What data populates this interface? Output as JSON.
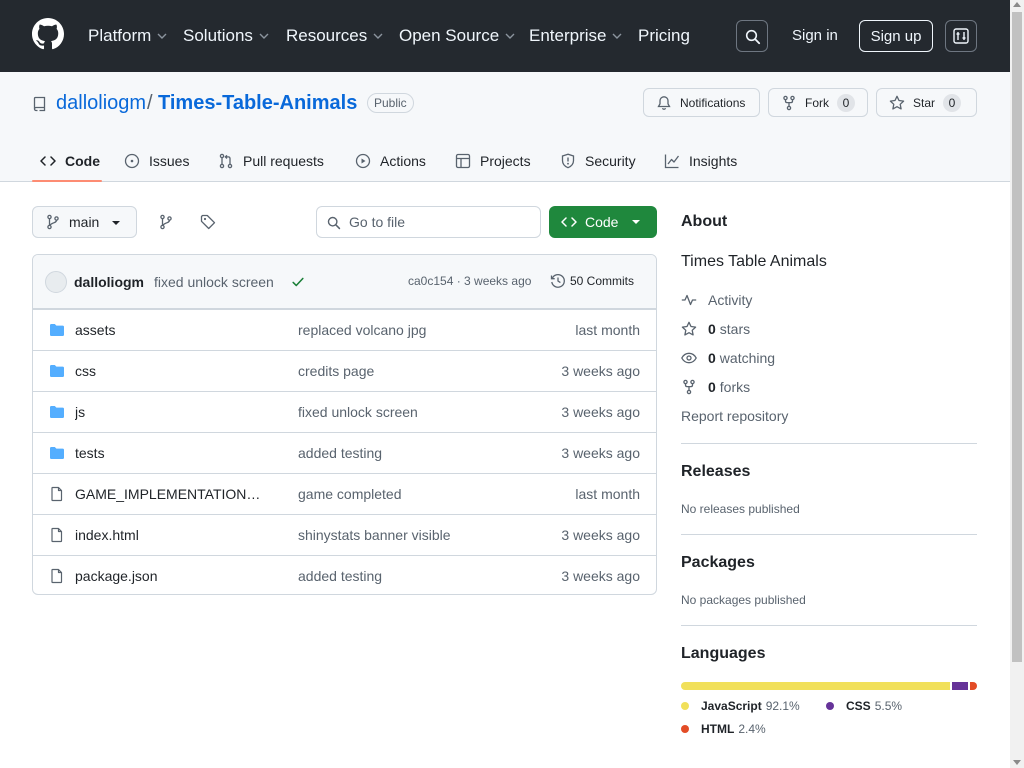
{
  "header": {
    "nav": [
      {
        "label": "Platform"
      },
      {
        "label": "Solutions"
      },
      {
        "label": "Resources"
      },
      {
        "label": "Open Source"
      },
      {
        "label": "Enterprise"
      },
      {
        "label": "Pricing"
      }
    ],
    "sign_in": "Sign in",
    "sign_up": "Sign up"
  },
  "repo": {
    "owner": "dalloliogm",
    "separator": "/",
    "name": "Times-Table-Animals",
    "visibility": "Public",
    "notifications_label": "Notifications",
    "fork_label": "Fork",
    "fork_count": "0",
    "star_label": "Star",
    "star_count": "0"
  },
  "tabs": [
    {
      "label": "Code",
      "icon": "code-icon"
    },
    {
      "label": "Issues",
      "icon": "issue-icon"
    },
    {
      "label": "Pull requests",
      "icon": "pull-request-icon"
    },
    {
      "label": "Actions",
      "icon": "play-icon"
    },
    {
      "label": "Projects",
      "icon": "table-icon"
    },
    {
      "label": "Security",
      "icon": "shield-icon"
    },
    {
      "label": "Insights",
      "icon": "graph-icon"
    }
  ],
  "toolbar": {
    "branch": "main",
    "goto_placeholder": "Go to file",
    "code_label": "Code"
  },
  "commit": {
    "author": "dalloliogm",
    "message": "fixed unlock screen",
    "hash_time": "ca0c154 · 3 weeks ago",
    "commits": "50 Commits"
  },
  "files": [
    {
      "type": "dir",
      "name": "assets",
      "message": "replaced volcano jpg",
      "age": "last month"
    },
    {
      "type": "dir",
      "name": "css",
      "message": "credits page",
      "age": "3 weeks ago"
    },
    {
      "type": "dir",
      "name": "js",
      "message": "fixed unlock screen",
      "age": "3 weeks ago"
    },
    {
      "type": "dir",
      "name": "tests",
      "message": "added testing",
      "age": "3 weeks ago"
    },
    {
      "type": "file",
      "name": "GAME_IMPLEMENTATION…",
      "message": "game completed",
      "age": "last month"
    },
    {
      "type": "file",
      "name": "index.html",
      "message": "shinystats banner visible",
      "age": "3 weeks ago"
    },
    {
      "type": "file",
      "name": "package.json",
      "message": "added testing",
      "age": "3 weeks ago"
    }
  ],
  "about": {
    "heading": "About",
    "description": "Times Table Animals",
    "activity": "Activity",
    "stars_count": "0",
    "stars_label": "stars",
    "watching_count": "0",
    "watching_label": "watching",
    "forks_count": "0",
    "forks_label": "forks",
    "report": "Report repository"
  },
  "releases": {
    "heading": "Releases",
    "text": "No releases published"
  },
  "packages": {
    "heading": "Packages",
    "text": "No packages published"
  },
  "languages": {
    "heading": "Languages",
    "items": [
      {
        "name": "JavaScript",
        "percent": "92.1%",
        "value": 92.1,
        "color": "#f1e05a"
      },
      {
        "name": "CSS",
        "percent": "5.5%",
        "value": 5.5,
        "color": "#663399"
      },
      {
        "name": "HTML",
        "percent": "2.4%",
        "value": 2.4,
        "color": "#e34c26"
      }
    ]
  },
  "colors": {
    "header_bg": "#24292f",
    "link": "#0969da",
    "code_button": "#1f883d",
    "tab_underline": "#fd8c73"
  }
}
